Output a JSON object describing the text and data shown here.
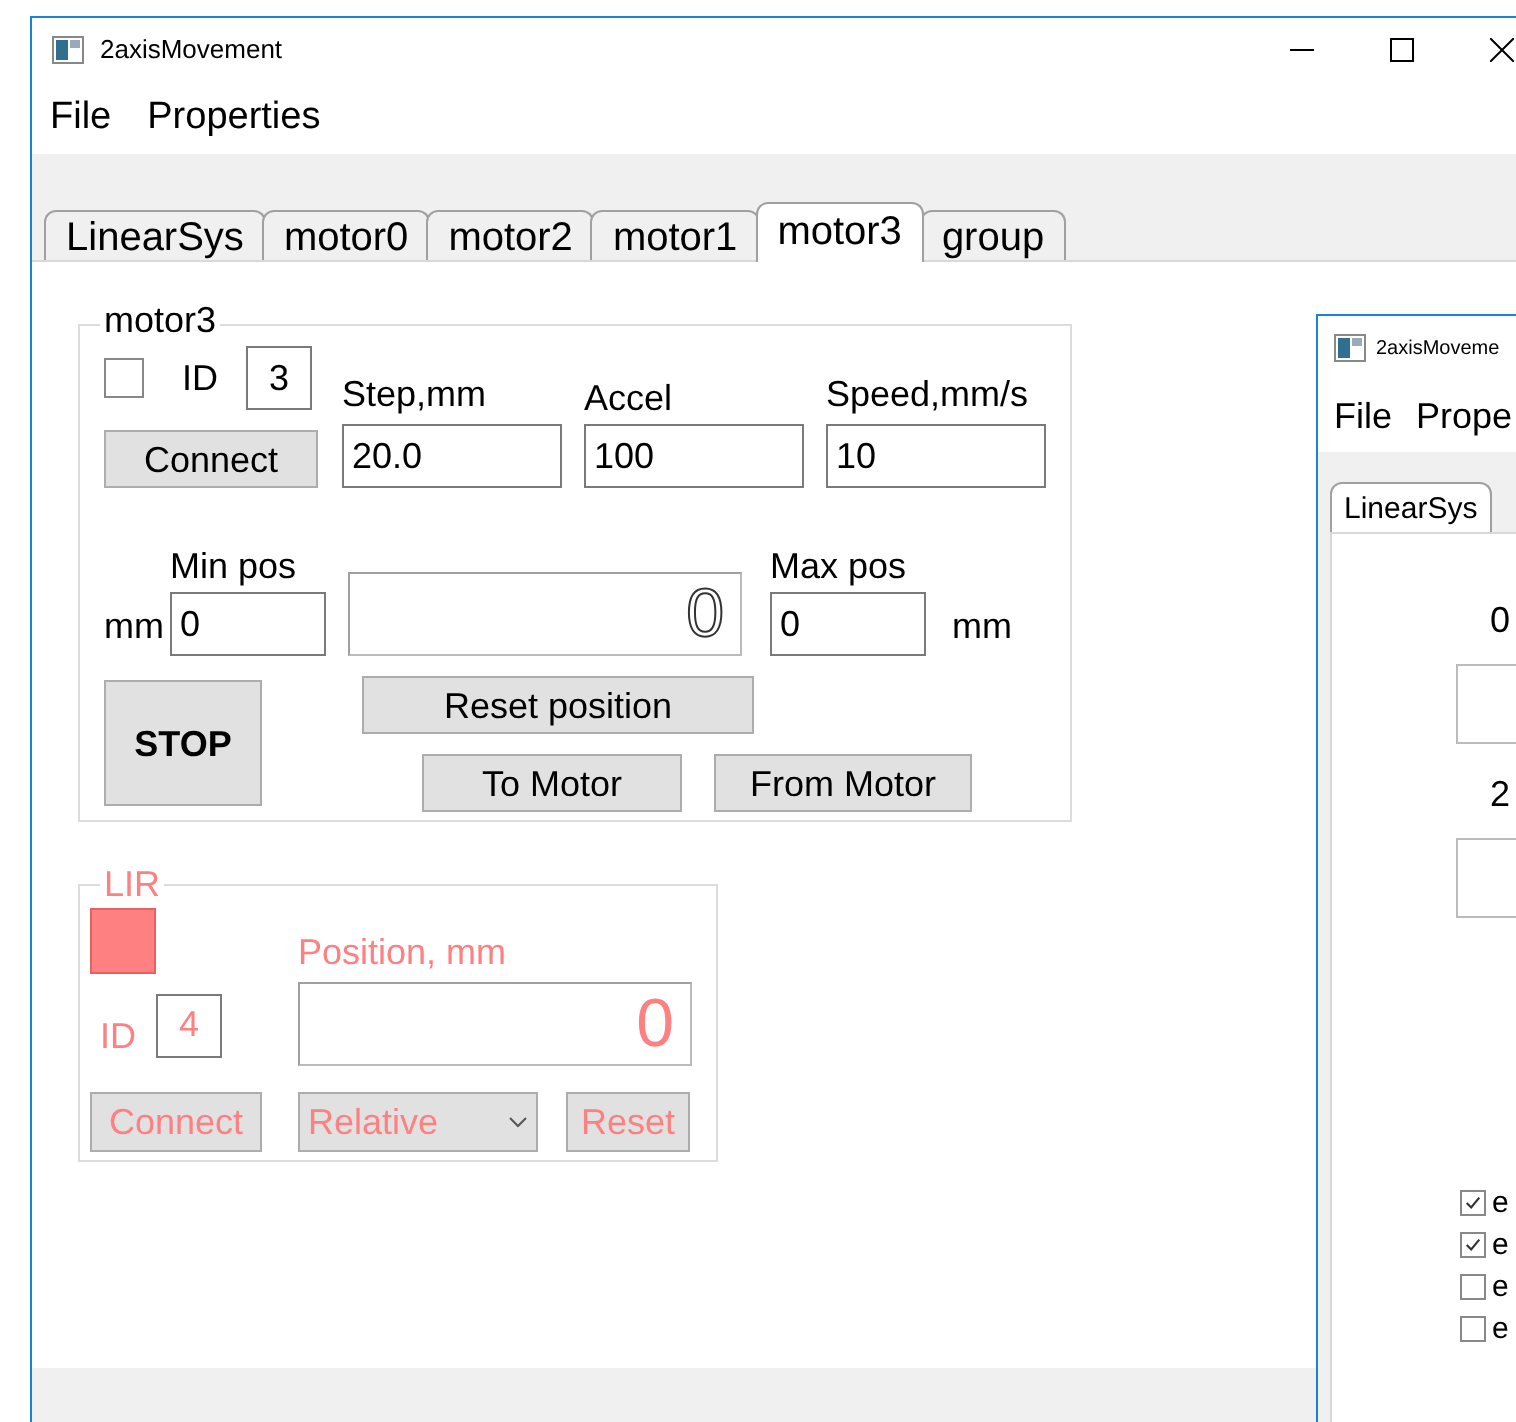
{
  "window": {
    "title": "2axisMovement"
  },
  "menu": [
    {
      "label": "File"
    },
    {
      "label": "Properties"
    }
  ],
  "tabs": [
    {
      "label": "LinearSys",
      "selected": false
    },
    {
      "label": "motor0",
      "selected": false
    },
    {
      "label": "motor2",
      "selected": false
    },
    {
      "label": "motor1",
      "selected": false
    },
    {
      "label": "motor3",
      "selected": true
    },
    {
      "label": "group",
      "selected": false
    }
  ],
  "motor": {
    "title": "motor3",
    "checked": false,
    "id_label": "ID",
    "id": "3",
    "connect": "Connect",
    "fields": [
      {
        "label": "Step,mm",
        "value": "20.0"
      },
      {
        "label": "Accel",
        "value": "100"
      },
      {
        "label": "Speed,mm/s",
        "value": "10"
      }
    ],
    "min_pos": {
      "unit": "mm",
      "label": "Min pos",
      "value": "0"
    },
    "display": "0",
    "max_pos": {
      "label": "Max pos",
      "value": "0",
      "unit": "mm"
    },
    "stop": "STOP",
    "reset": "Reset position",
    "to_motor": "To Motor",
    "from_motor": "From Motor"
  },
  "lir": {
    "title": "LIR",
    "indicator_on": true,
    "id_label": "ID",
    "id": "4",
    "position_label": "Position, mm",
    "display": "0",
    "connect": "Connect",
    "mode": "Relative",
    "reset": "Reset"
  },
  "second_window": {
    "title": "2axisMoveme",
    "menu": [
      {
        "label": "File"
      },
      {
        "label": "Prope"
      }
    ],
    "tabs": [
      {
        "label": "LinearSys",
        "selected": true
      }
    ],
    "labels": [
      "0",
      "2"
    ],
    "checkboxes": [
      {
        "label": "e",
        "checked": true
      },
      {
        "label": "e",
        "checked": true
      },
      {
        "label": "e",
        "checked": false
      },
      {
        "label": "e",
        "checked": false
      }
    ]
  }
}
